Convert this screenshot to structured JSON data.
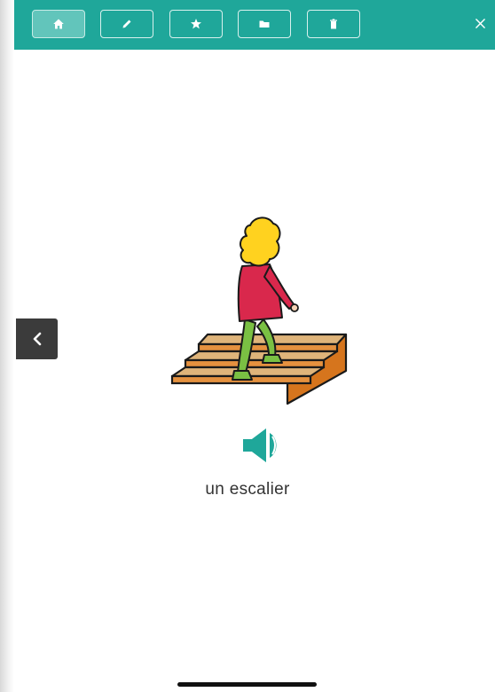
{
  "toolbar": {
    "color": "#1fa79a",
    "buttons": [
      {
        "icon": "home-icon",
        "active": true
      },
      {
        "icon": "pencil-icon",
        "active": false
      },
      {
        "icon": "star-icon",
        "active": false
      },
      {
        "icon": "folder-icon",
        "active": false
      },
      {
        "icon": "trash-icon",
        "active": false
      }
    ],
    "close_label": "×"
  },
  "navigation": {
    "back_icon": "chevron-left-icon"
  },
  "card": {
    "image": "person-climbing-stairs",
    "audio_icon": "speaker-icon",
    "audio_color": "#1fa79a",
    "caption": "un escalier"
  }
}
